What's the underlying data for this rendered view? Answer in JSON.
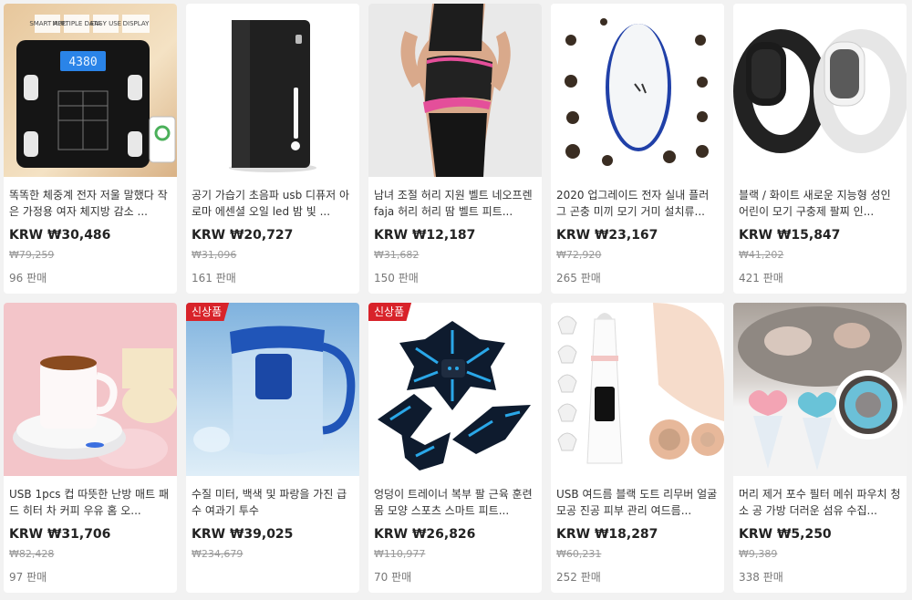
{
  "products": [
    {
      "title": "똑똑한 체중계 전자 저울 말했다 작은 가정용 여자 체지방 감소 ...",
      "price": "KRW ₩30,486",
      "original_price": "₩79,259",
      "sold": "96 판매",
      "badge": "",
      "thumb_labels": [
        "SMART APP",
        "MULTIPLE DATA",
        "EASY USE",
        "DISPLAY"
      ],
      "thumb_reading": "4380"
    },
    {
      "title": "공기 가습기 초음파 usb 디퓨저 아로마 에센셜 오일 led 밤 빛 ...",
      "price": "KRW ₩20,727",
      "original_price": "₩31,096",
      "sold": "161 판매",
      "badge": ""
    },
    {
      "title": "남녀 조절 허리 지원 벨트 네오프렌 faja 허리 허리 땀 벨트 피트...",
      "price": "KRW ₩12,187",
      "original_price": "₩31,682",
      "sold": "150 판매",
      "badge": ""
    },
    {
      "title": "2020 업그레이드 전자 실내 플러그 곤충 미끼 모기 거미 설치류...",
      "price": "KRW ₩23,167",
      "original_price": "₩72,920",
      "sold": "265 판매",
      "badge": ""
    },
    {
      "title": "블랙 / 화이트 새로운 지능형 성인 어린이 모기 구충제 팔찌 인...",
      "price": "KRW ₩15,847",
      "original_price": "₩41,202",
      "sold": "421 판매",
      "badge": ""
    },
    {
      "title": "USB 1pcs 컵 따뜻한 난방 매트 패드 히터 차 커피 우유 홈 오...",
      "price": "KRW ₩31,706",
      "original_price": "₩82,428",
      "sold": "97 판매",
      "badge": ""
    },
    {
      "title": "수질 미터, 백색 및 파랑을 가진 급수 여과기 투수",
      "price": "KRW ₩39,025",
      "original_price": "₩234,679",
      "sold": "",
      "badge": "신상품"
    },
    {
      "title": "엉덩이 트레이너 복부 팔 근육 훈련 몸 모양 스포츠 스마트 피트...",
      "price": "KRW ₩26,826",
      "original_price": "₩110,977",
      "sold": "70 판매",
      "badge": "신상품"
    },
    {
      "title": "USB 여드름 블랙 도트 리무버 얼굴 모공 진공 피부 관리 여드름...",
      "price": "KRW ₩18,287",
      "original_price": "₩60,231",
      "sold": "252 판매",
      "badge": ""
    },
    {
      "title": "머리 제거 포수 필터 메쉬 파우치 청소 공 가방 더러운 섬유 수집...",
      "price": "KRW ₩5,250",
      "original_price": "₩9,389",
      "sold": "338 판매",
      "badge": ""
    }
  ]
}
